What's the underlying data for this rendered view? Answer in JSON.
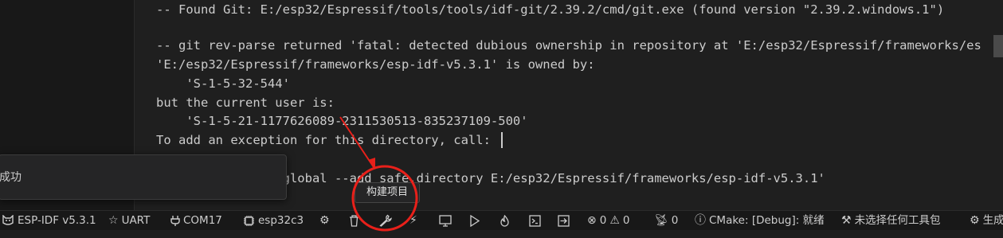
{
  "terminal": {
    "lines": [
      "-- Found Git: E:/esp32/Espressif/tools/tools/idf-git/2.39.2/cmd/git.exe (found version \"2.39.2.windows.1\")",
      "",
      "-- git rev-parse returned 'fatal: detected dubious ownership in repository at 'E:/esp32/Espressif/frameworks/es",
      "'E:/esp32/Espressif/frameworks/esp-idf-v5.3.1' is owned by:",
      "    'S-1-5-32-544'",
      "but the current user is:",
      "    'S-1-5-21-1177626089-2311530513-835237109-500'",
      "To add an exception for this directory, call:",
      "",
      "    git config --global --add safe.directory E:/esp32/Espressif/frameworks/esp-idf-v5.3.1'"
    ]
  },
  "toast": {
    "message": "成功"
  },
  "tooltip": {
    "text": "构建项目"
  },
  "statusbar": {
    "idf_version": "ESP-IDF v5.3.1",
    "uart": "UART",
    "port": "COM17",
    "target": "esp32c3",
    "errors": "0",
    "warnings": "0",
    "ports_count": "0",
    "cmake": "CMake: [Debug]: 就绪",
    "kit": "未选择任何工具包",
    "build": "生成"
  },
  "colors": {
    "annotation_red": "#e8201a",
    "background": "#1f1f1f",
    "statusbar_bg": "#181818",
    "text": "#cccccc"
  }
}
